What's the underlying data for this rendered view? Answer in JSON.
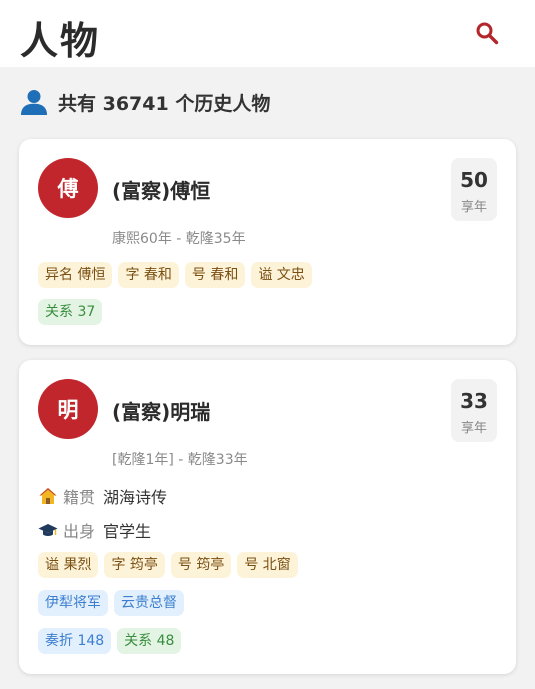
{
  "header": {
    "title": "人物"
  },
  "summary": {
    "text": "共有 36741 个历史人物"
  },
  "colors": {
    "accent": "#c0262c",
    "alias_tag": "#fdf3d8",
    "relation_tag": "#e3f4e4",
    "office_tag": "#e2effc"
  },
  "persons": [
    {
      "avatar": "傅",
      "name": "(富察)傅恒",
      "age": "50",
      "age_label": "享年",
      "period": "康熙60年 - 乾隆35年",
      "aliases": [
        "异名 傅恒",
        "字 春和",
        "号 春和",
        "谥 文忠"
      ],
      "relations": "关系 37"
    },
    {
      "avatar": "明",
      "name": "(富察)明瑞",
      "age": "33",
      "age_label": "享年",
      "period": "[乾隆1年] - 乾隆33年",
      "native_key": "籍贯",
      "native_val": "湖海诗传",
      "origin_key": "出身",
      "origin_val": "官学生",
      "aliases": [
        "谥 果烈",
        "字 筠亭",
        "号 筠亭",
        "号 北窗"
      ],
      "offices": [
        "伊犁将军",
        "云贵总督"
      ],
      "memorials": "奏折 148",
      "relations": "关系 48"
    }
  ]
}
